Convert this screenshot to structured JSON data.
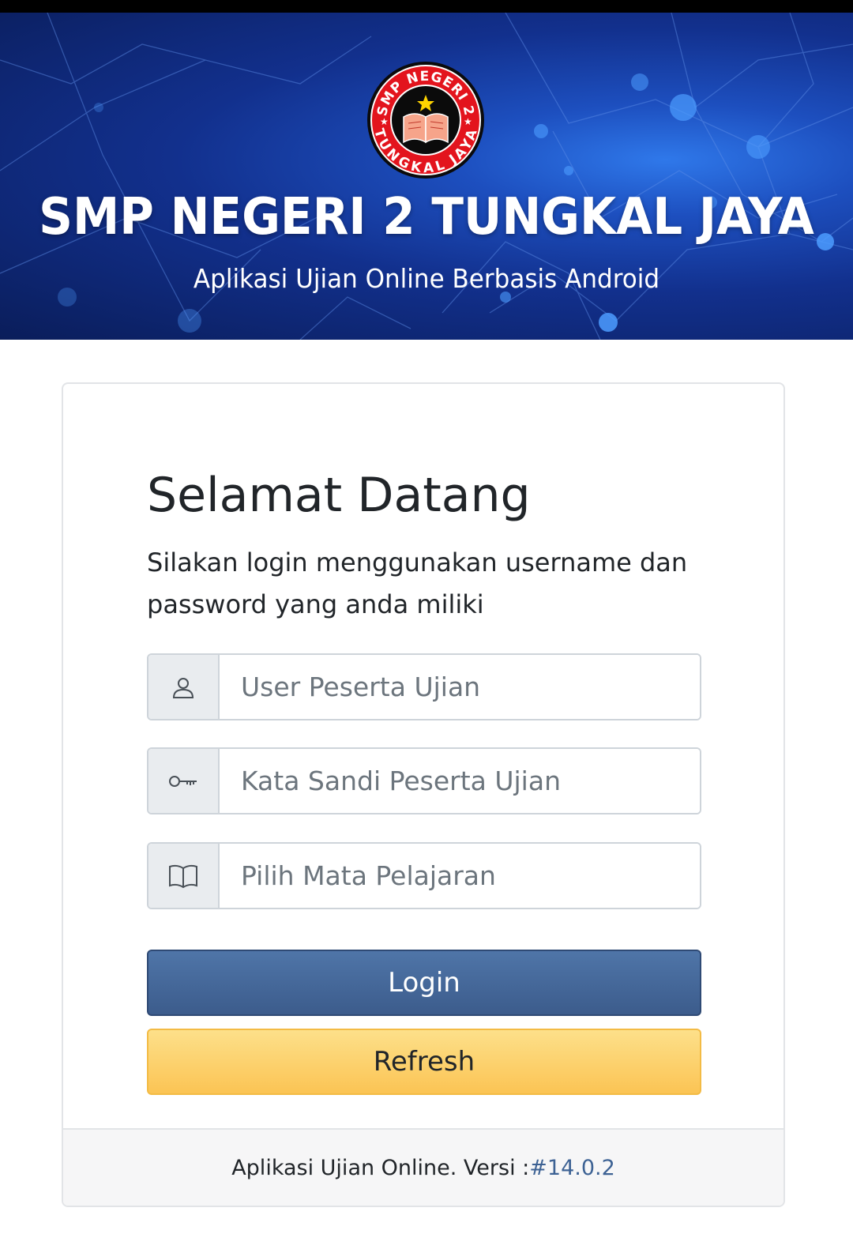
{
  "header": {
    "school_name": "SMP NEGERI 2 TUNGKAL JAYA",
    "subtitle": "Aplikasi Ujian Online Berbasis Android",
    "logo": {
      "ring_text_top": "SMP NEGERI 2",
      "ring_text_bottom": "TUNGKAL JAYA",
      "icon": "open-book-star-icon"
    }
  },
  "login": {
    "welcome": "Selamat Datang",
    "description": "Silakan login menggunakan username dan password yang anda miliki",
    "username": {
      "placeholder": "User Peserta Ujian",
      "value": "",
      "icon": "user-icon"
    },
    "password": {
      "placeholder": "Kata Sandi Peserta Ujian",
      "value": "",
      "icon": "key-icon"
    },
    "subject": {
      "placeholder": "Pilih Mata Pelajaran",
      "value": "",
      "icon": "book-icon"
    },
    "login_label": "Login",
    "refresh_label": "Refresh"
  },
  "footer": {
    "text": "Aplikasi Ujian Online. Versi :",
    "version": "#14.0.2"
  },
  "colors": {
    "login_button": "#466897",
    "refresh_button": "#fcd36c",
    "version_link": "#3d6294",
    "banner": "#12308d"
  }
}
